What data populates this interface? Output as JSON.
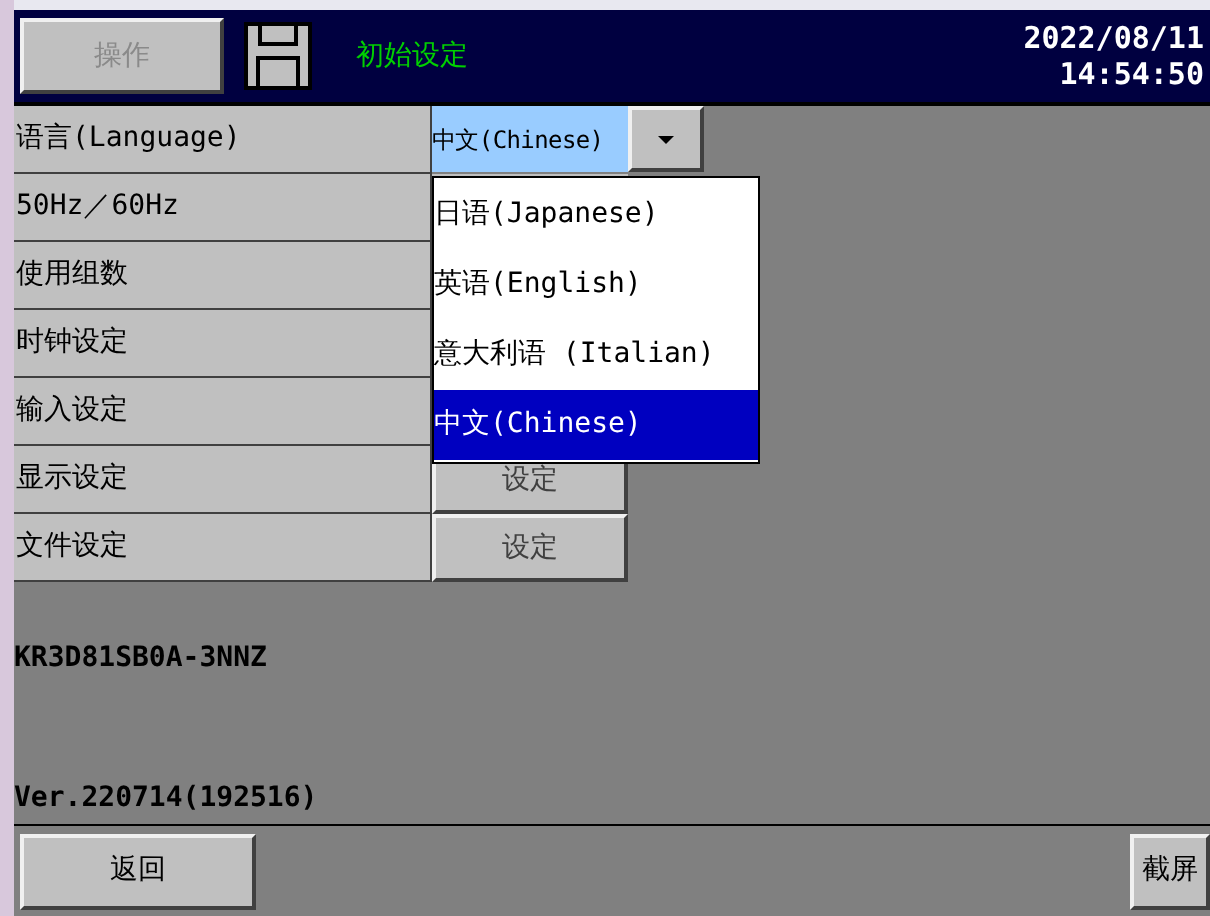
{
  "header": {
    "operation_button": {
      "label": "操作",
      "disabled": true
    },
    "title": "初始设定",
    "date": "2022/08/11",
    "time": "14:54:50"
  },
  "settings": [
    {
      "label": "语言(Language)",
      "kind": "dropdown",
      "value": "中文(Chinese)"
    },
    {
      "label": "50Hz／60Hz",
      "kind": "plain"
    },
    {
      "label": "使用组数",
      "kind": "plain"
    },
    {
      "label": "时钟设定",
      "kind": "plain"
    },
    {
      "label": "输入设定",
      "kind": "plain"
    },
    {
      "label": "显示设定",
      "kind": "button",
      "button": "设定"
    },
    {
      "label": "文件设定",
      "kind": "button",
      "button": "设定"
    }
  ],
  "dropdown_options": [
    {
      "label": "日语(Japanese)",
      "selected": false
    },
    {
      "label": "英语(English)",
      "selected": false
    },
    {
      "label": "意大利语 (Italian)",
      "selected": false
    },
    {
      "label": "中文(Chinese)",
      "selected": true
    }
  ],
  "model": "KR3D81SB0A-3NNZ",
  "version": "Ver.220714(192516)",
  "footer": {
    "back_button": "返回",
    "screenshot_button": "截屏"
  }
}
